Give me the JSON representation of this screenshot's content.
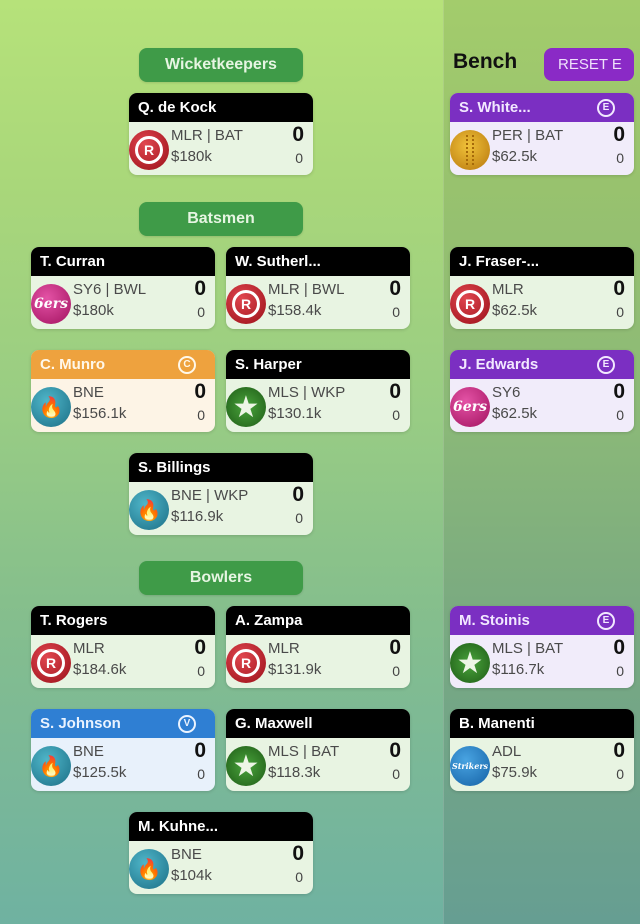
{
  "sections": {
    "wicketkeepers": "Wicketkeepers",
    "batsmen": "Batsmen",
    "bowlers": "Bowlers"
  },
  "bench": {
    "title": "Bench",
    "reset_label": "RESET E"
  },
  "players": [
    {
      "name": "Q. de Kock",
      "team": "MLR",
      "line1": "MLR | BAT",
      "price": "$180k",
      "points": "0",
      "sub_points": "0",
      "badge": ""
    },
    {
      "name": "T. Curran",
      "team": "SY6",
      "line1": "SY6 | BWL",
      "price": "$180k",
      "points": "0",
      "sub_points": "0",
      "badge": ""
    },
    {
      "name": "W. Sutherl...",
      "team": "MLR",
      "line1": "MLR | BWL",
      "price": "$158.4k",
      "points": "0",
      "sub_points": "0",
      "badge": ""
    },
    {
      "name": "C. Munro",
      "team": "BNE",
      "line1": "BNE",
      "price": "$156.1k",
      "points": "0",
      "sub_points": "0",
      "badge": "C"
    },
    {
      "name": "S. Harper",
      "team": "MLS",
      "line1": "MLS | WKP",
      "price": "$130.1k",
      "points": "0",
      "sub_points": "0",
      "badge": ""
    },
    {
      "name": "S. Billings",
      "team": "BNE",
      "line1": "BNE | WKP",
      "price": "$116.9k",
      "points": "0",
      "sub_points": "0",
      "badge": ""
    },
    {
      "name": "T. Rogers",
      "team": "MLR",
      "line1": "MLR",
      "price": "$184.6k",
      "points": "0",
      "sub_points": "0",
      "badge": ""
    },
    {
      "name": "A. Zampa",
      "team": "MLR",
      "line1": "MLR",
      "price": "$131.9k",
      "points": "0",
      "sub_points": "0",
      "badge": ""
    },
    {
      "name": "S. Johnson",
      "team": "BNE",
      "line1": "BNE",
      "price": "$125.5k",
      "points": "0",
      "sub_points": "0",
      "badge": "V"
    },
    {
      "name": "G. Maxwell",
      "team": "MLS",
      "line1": "MLS | BAT",
      "price": "$118.3k",
      "points": "0",
      "sub_points": "0",
      "badge": ""
    },
    {
      "name": "M. Kuhne...",
      "team": "BNE",
      "line1": "BNE",
      "price": "$104k",
      "points": "0",
      "sub_points": "0",
      "badge": ""
    }
  ],
  "bench_players": [
    {
      "name": "S. White...",
      "team": "PER",
      "line1": "PER | BAT",
      "price": "$62.5k",
      "points": "0",
      "sub_points": "0",
      "badge": "E"
    },
    {
      "name": "J. Fraser-...",
      "team": "MLR",
      "line1": "MLR",
      "price": "$62.5k",
      "points": "0",
      "sub_points": "0",
      "badge": ""
    },
    {
      "name": "J. Edwards",
      "team": "SY6",
      "line1": "SY6",
      "price": "$62.5k",
      "points": "0",
      "sub_points": "0",
      "badge": "E"
    },
    {
      "name": "M. Stoinis",
      "team": "MLS",
      "line1": "MLS | BAT",
      "price": "$116.7k",
      "points": "0",
      "sub_points": "0",
      "badge": "E"
    },
    {
      "name": "B. Manenti",
      "team": "ADL",
      "line1": "ADL",
      "price": "$75.9k",
      "points": "0",
      "sub_points": "0",
      "badge": ""
    }
  ],
  "team_logos": {
    "MLR": {
      "icon": "melbourne-renegades-logo",
      "glyph": "R"
    },
    "SY6": {
      "icon": "sydney-sixers-logo",
      "glyph": "6ers"
    },
    "BNE": {
      "icon": "brisbane-heat-logo",
      "glyph": "🔥"
    },
    "MLS": {
      "icon": "melbourne-stars-logo",
      "glyph": "★"
    },
    "PER": {
      "icon": "perth-scorchers-logo",
      "glyph": ""
    },
    "ADL": {
      "icon": "adelaide-strikers-logo",
      "glyph": "Strikers"
    }
  },
  "colors": {
    "section_pill": "#3f9b48",
    "captain": "#eea23e",
    "vice_captain": "#2f7fd3",
    "emergency": "#7b2fc2",
    "reset_button": "#8a2ac6"
  }
}
